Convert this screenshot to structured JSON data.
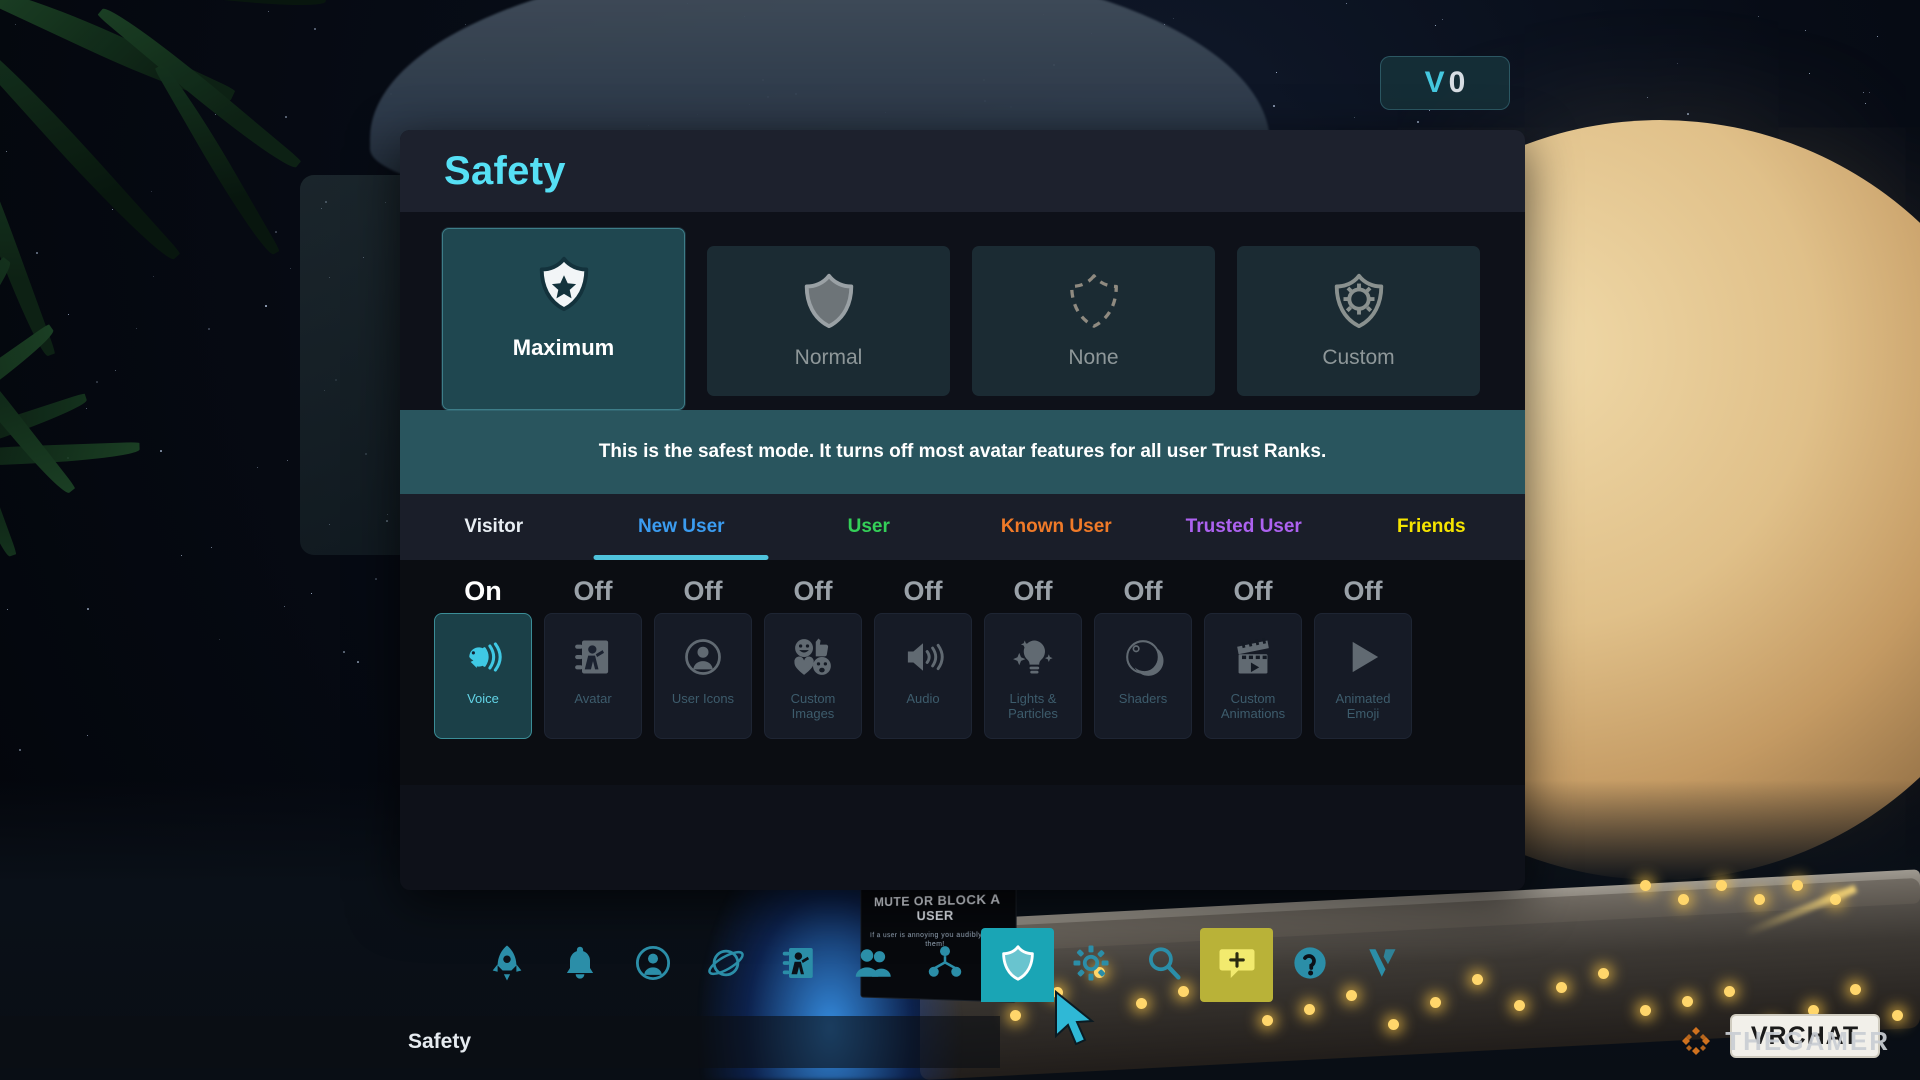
{
  "badge": {
    "logo": "V",
    "count": "0"
  },
  "panel": {
    "title": "Safety",
    "description": "This is the safest mode. It turns off most avatar features for all user Trust Ranks.",
    "modes": [
      {
        "label": "Maximum",
        "icon": "shield-star-icon",
        "active": true
      },
      {
        "label": "Normal",
        "icon": "shield-filled-icon",
        "active": false
      },
      {
        "label": "None",
        "icon": "shield-dashed-icon",
        "active": false
      },
      {
        "label": "Custom",
        "icon": "shield-gear-icon",
        "active": false
      }
    ],
    "trust_tabs": [
      {
        "label": "Visitor",
        "color": "#e8eef3",
        "selected": false
      },
      {
        "label": "New User",
        "color": "#3b9cf0",
        "selected": true
      },
      {
        "label": "User",
        "color": "#34d058",
        "selected": false
      },
      {
        "label": "Known User",
        "color": "#f07a28",
        "selected": false
      },
      {
        "label": "Trusted User",
        "color": "#ad62f0",
        "selected": false
      },
      {
        "label": "Friends",
        "color": "#f5e400",
        "selected": false
      }
    ],
    "features": [
      {
        "label": "Voice",
        "state": "On",
        "icon": "voice-icon",
        "on": true
      },
      {
        "label": "Avatar",
        "state": "Off",
        "icon": "avatar-icon",
        "on": false
      },
      {
        "label": "User Icons",
        "state": "Off",
        "icon": "user-icon",
        "on": false
      },
      {
        "label": "Custom Images",
        "state": "Off",
        "icon": "emoji-faces-icon",
        "on": false
      },
      {
        "label": "Audio",
        "state": "Off",
        "icon": "speaker-icon",
        "on": false
      },
      {
        "label": "Lights & Particles",
        "state": "Off",
        "icon": "lightbulb-icon",
        "on": false
      },
      {
        "label": "Shaders",
        "state": "Off",
        "icon": "sphere-icon",
        "on": false
      },
      {
        "label": "Custom Animations",
        "state": "Off",
        "icon": "clapperboard-icon",
        "on": false
      },
      {
        "label": "Animated Emoji",
        "state": "Off",
        "icon": "play-icon",
        "on": false
      }
    ],
    "accent_color": "#56e0f5",
    "active_mode_color": "#1f4750"
  },
  "toolbar": {
    "items": [
      {
        "name": "rocket-icon",
        "label": "Rocket",
        "active": false
      },
      {
        "name": "bell-icon",
        "label": "Notifications",
        "active": false
      },
      {
        "name": "profile-icon",
        "label": "Profile",
        "active": false
      },
      {
        "name": "worlds-icon",
        "label": "Worlds",
        "active": false
      },
      {
        "name": "avatars-icon",
        "label": "Avatars",
        "active": false
      },
      {
        "name": "social-icon",
        "label": "Social",
        "active": false
      },
      {
        "name": "groups-icon",
        "label": "Groups",
        "active": false
      },
      {
        "name": "safety-icon",
        "label": "Safety",
        "active": true
      },
      {
        "name": "settings-icon",
        "label": "Settings",
        "active": false
      },
      {
        "name": "search-icon",
        "label": "Search",
        "active": false
      },
      {
        "name": "feedback-icon",
        "label": "Feedback",
        "active": false,
        "highlight": true
      },
      {
        "name": "help-icon",
        "label": "Help",
        "active": false
      },
      {
        "name": "vrchat-icon",
        "label": "VRChat",
        "active": false
      }
    ]
  },
  "status": {
    "label": "Safety"
  },
  "scene": {
    "poster_line1": "MUTE OR BLOCK",
    "poster_line2": "A USER",
    "poster_body": "If a user is annoying you audibly, mute them!",
    "plate_text": "VRCHAT"
  },
  "watermark": {
    "text": "THEGAMER"
  }
}
